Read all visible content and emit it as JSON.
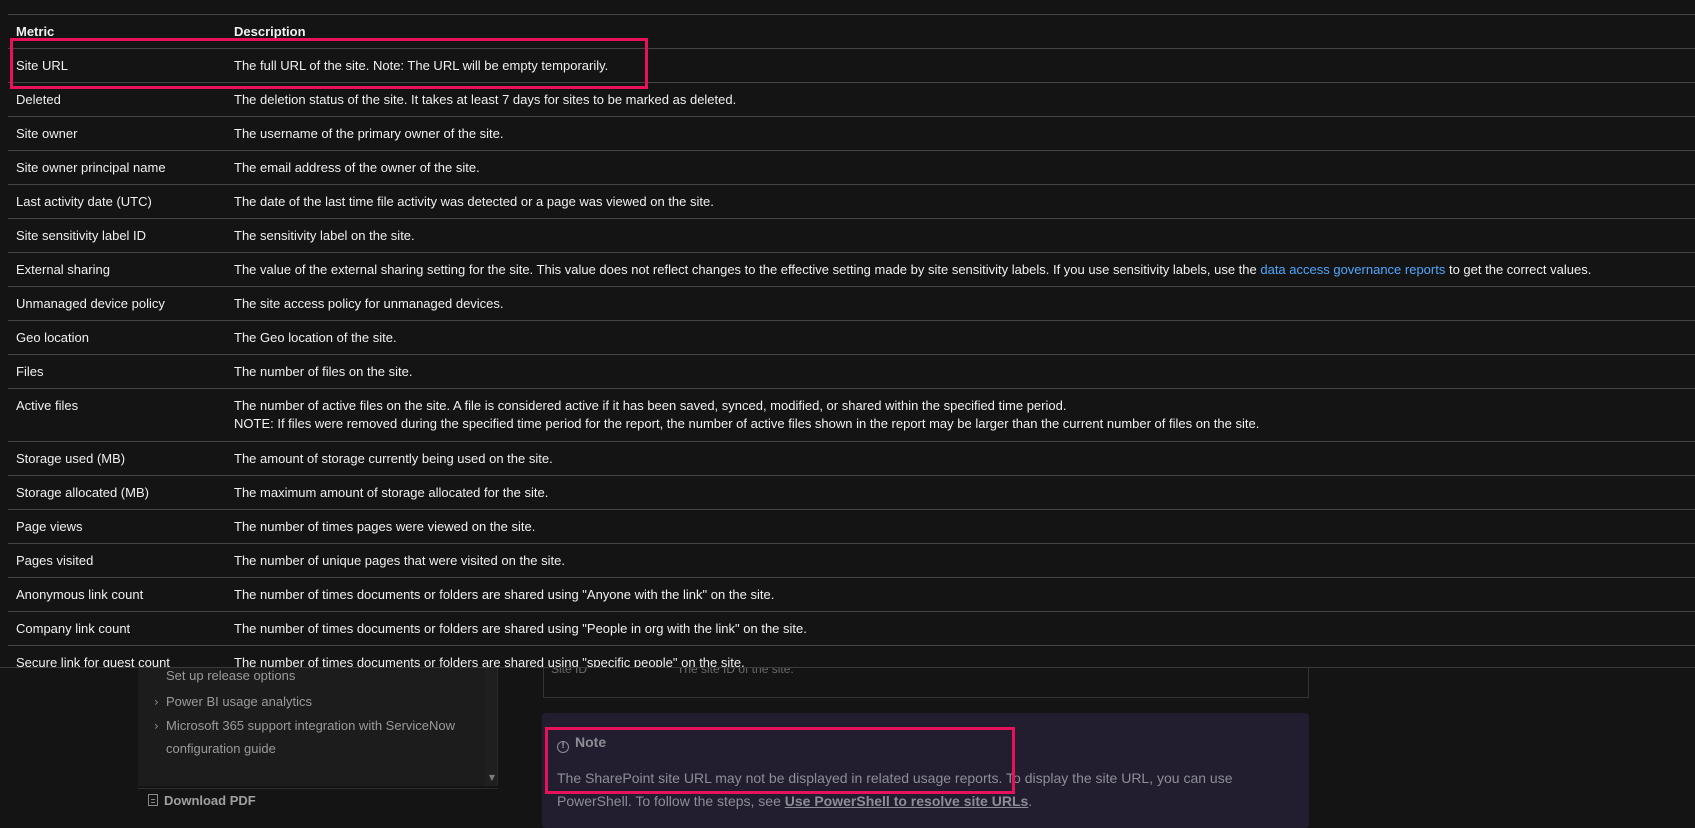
{
  "table": {
    "headers": {
      "metric": "Metric",
      "description": "Description"
    },
    "rows": [
      {
        "metric": "Site URL",
        "description": "The full URL of the site. Note: The URL will be empty temporarily."
      },
      {
        "metric": "Deleted",
        "description": "The deletion status of the site. It takes at least 7 days for sites to be marked as deleted."
      },
      {
        "metric": "Site owner",
        "description": "The username of the primary owner of the site."
      },
      {
        "metric": "Site owner principal name",
        "description": "The email address of the owner of the site."
      },
      {
        "metric": "Last activity date (UTC)",
        "description": "The date of the last time file activity was detected or a page was viewed on the site."
      },
      {
        "metric": "Site sensitivity label ID",
        "description": "The sensitivity label on the site."
      },
      {
        "metric": "External sharing",
        "description_before": "The value of the external sharing setting for the site. This value does not reflect changes to the effective setting made by site sensitivity labels. If you use sensitivity labels, use the ",
        "description_link": "data access governance reports",
        "description_after": " to get the correct values."
      },
      {
        "metric": "Unmanaged device policy",
        "description": "The site access policy for unmanaged devices."
      },
      {
        "metric": "Geo location",
        "description": "The Geo location of the site."
      },
      {
        "metric": "Files",
        "description": "The number of files on the site."
      },
      {
        "metric": "Active files",
        "description_line1": "The number of active files on the site. A file is considered active if it has been saved, synced, modified, or shared within the specified time period.",
        "description_line2": "NOTE: If files were removed during the specified time period for the report, the number of active files shown in the report may be larger than the current number of files on the site."
      },
      {
        "metric": "Storage used (MB)",
        "description": "The amount of storage currently being used on the site."
      },
      {
        "metric": "Storage allocated (MB)",
        "description": "The maximum amount of storage allocated for the site."
      },
      {
        "metric": "Page views",
        "description": "The number of times pages were viewed on the site."
      },
      {
        "metric": "Pages visited",
        "description": "The number of unique pages that were visited on the site."
      },
      {
        "metric": "Anonymous link count",
        "description": "The number of times documents or folders are shared using \"Anyone with the link\" on the site."
      },
      {
        "metric": "Company link count",
        "description": "The number of times documents or folders are shared using \"People in org with the link\" on the site."
      },
      {
        "metric": "Secure link for guest count",
        "description": "The number of times documents or folders are shared using \"specific people\" on the site."
      }
    ]
  },
  "toc": {
    "items": [
      "Set up release options",
      "Power BI usage analytics",
      "Microsoft 365 support integration with ServiceNow",
      "configuration guide"
    ],
    "download_pdf": "Download PDF"
  },
  "bg_table": {
    "metric": "Site ID",
    "description": "The site ID of the site."
  },
  "note": {
    "title": "Note",
    "body_text": "The SharePoint site URL may not be displayed in related usage reports. To display the site URL, you can use PowerShell. To follow the steps, see ",
    "link": "Use PowerShell to resolve site URLs",
    "body_end": "."
  },
  "colors": {
    "background": "#141414",
    "highlight": "#e8125c",
    "link": "#4ea6ff",
    "note_bg": "#221e30"
  }
}
